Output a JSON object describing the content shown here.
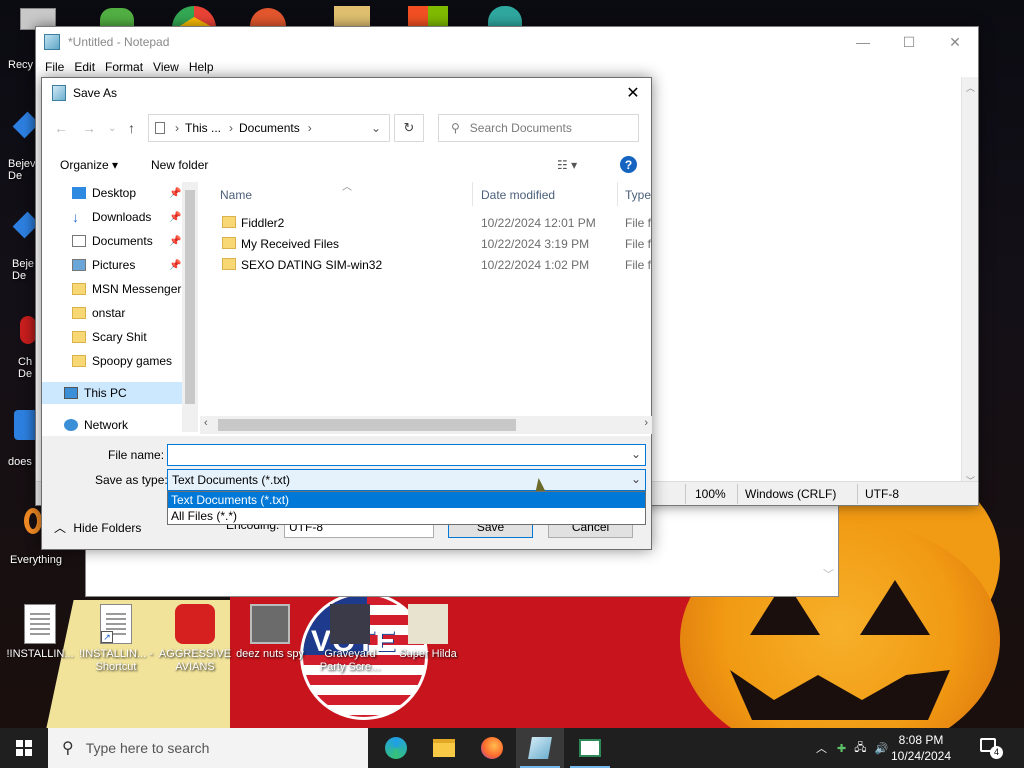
{
  "desktop": {
    "icons": [
      {
        "label": "Recy"
      },
      {
        "label": "Bejev De"
      },
      {
        "label": "Beje De"
      },
      {
        "label": "Ch De"
      },
      {
        "label": "does"
      },
      {
        "label": "Everything"
      },
      {
        "label": "!INSTALLIN..."
      },
      {
        "label": "!INSTALLIN... - Shortcut"
      },
      {
        "label": "AGGRESSIVE AVIANS"
      },
      {
        "label": "deez nuts spy"
      },
      {
        "label": "Graveyard Party Scre..."
      },
      {
        "label": "Super Hilda"
      }
    ],
    "vote_text": "VOTE"
  },
  "notepad": {
    "title": "*Untitled - Notepad",
    "menu": [
      "File",
      "Edit",
      "Format",
      "View",
      "Help"
    ],
    "status": {
      "zoom": "100%",
      "line_endings": "Windows (CRLF)",
      "encoding": "UTF-8"
    }
  },
  "save_as": {
    "title": "Save As",
    "address": [
      "This ...",
      "Documents"
    ],
    "search_placeholder": "Search Documents",
    "toolbar": {
      "organize": "Organize",
      "new_folder": "New folder"
    },
    "nav_items": [
      {
        "label": "Desktop",
        "pinned": true
      },
      {
        "label": "Downloads",
        "pinned": true
      },
      {
        "label": "Documents",
        "pinned": true
      },
      {
        "label": "Pictures",
        "pinned": true
      },
      {
        "label": "MSN Messenger",
        "pinned": false
      },
      {
        "label": "onstar",
        "pinned": false
      },
      {
        "label": "Scary Shit",
        "pinned": false
      },
      {
        "label": "Spoopy games",
        "pinned": false
      },
      {
        "label": "This PC",
        "pinned": false
      },
      {
        "label": "Network",
        "pinned": false
      }
    ],
    "columns": {
      "name": "Name",
      "date": "Date modified",
      "type": "Type"
    },
    "files": [
      {
        "name": "Fiddler2",
        "date": "10/22/2024 12:01 PM",
        "type": "File fo"
      },
      {
        "name": "My Received Files",
        "date": "10/22/2024 3:19 PM",
        "type": "File fo"
      },
      {
        "name": "SEXO DATING SIM-win32",
        "date": "10/22/2024 1:02 PM",
        "type": "File fo"
      }
    ],
    "file_name_label": "File name:",
    "file_name_value": "",
    "save_type_label": "Save as type:",
    "save_type_value": "Text Documents (*.txt)",
    "save_type_options": [
      "Text Documents (*.txt)",
      "All Files  (*.*)"
    ],
    "encoding_label": "Encoding:",
    "encoding_value": "UTF-8",
    "hide_folders": "Hide Folders",
    "save_btn": "Save",
    "cancel_btn": "Cancel"
  },
  "taskbar": {
    "search_placeholder": "Type here to search",
    "time": "8:08 PM",
    "date": "10/24/2024",
    "notification_count": "4"
  }
}
